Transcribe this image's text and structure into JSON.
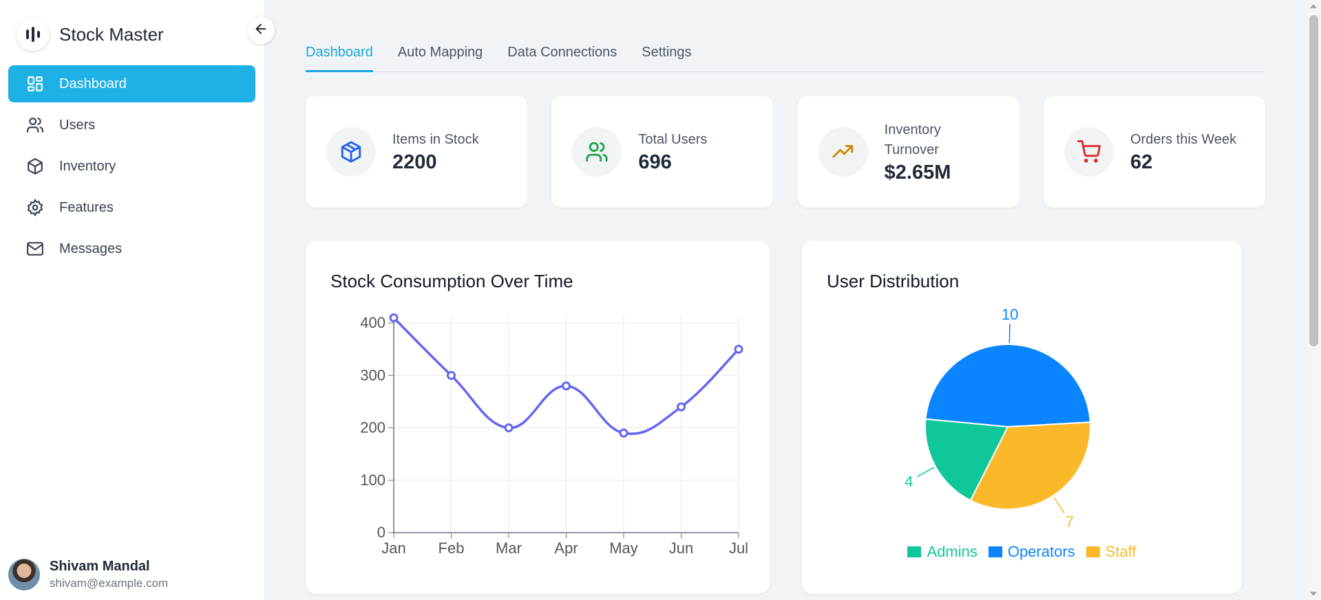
{
  "app": {
    "title": "Stock Master",
    "logo_icon": "bars-logo-icon",
    "collapse_icon": "arrow-left-icon"
  },
  "sidebar": {
    "items": [
      {
        "label": "Dashboard",
        "icon": "dashboard-grid-icon",
        "active": true
      },
      {
        "label": "Users",
        "icon": "users-icon",
        "active": false
      },
      {
        "label": "Inventory",
        "icon": "box-icon",
        "active": false
      },
      {
        "label": "Features",
        "icon": "gear-icon",
        "active": false
      },
      {
        "label": "Messages",
        "icon": "mail-icon",
        "active": false
      }
    ]
  },
  "user": {
    "name": "Shivam Mandal",
    "email": "shivam@example.com"
  },
  "tabs": [
    {
      "label": "Dashboard",
      "active": true
    },
    {
      "label": "Auto Mapping",
      "active": false
    },
    {
      "label": "Data Connections",
      "active": false
    },
    {
      "label": "Settings",
      "active": false
    }
  ],
  "stats": [
    {
      "label": "Items in Stock",
      "value": "2200",
      "icon": "box-icon",
      "color": "#2563eb"
    },
    {
      "label": "Total Users",
      "value": "696",
      "icon": "users-icon",
      "color": "#16a34a"
    },
    {
      "label": "Inventory Turnover",
      "value": "$2.65M",
      "icon": "trending-up-icon",
      "color": "#ca8a04"
    },
    {
      "label": "Orders this Week",
      "value": "62",
      "icon": "shopping-cart-icon",
      "color": "#dc2626"
    }
  ],
  "colors": {
    "accent": "#1fb0e6",
    "line": "#6366f1",
    "admins": "#10c79a",
    "operators": "#0a84ff",
    "staff": "#fbb829"
  },
  "chart_data": [
    {
      "type": "line",
      "title": "Stock Consumption Over Time",
      "categories": [
        "Jan",
        "Feb",
        "Mar",
        "Apr",
        "May",
        "Jun",
        "Jul"
      ],
      "values": [
        410,
        300,
        200,
        280,
        190,
        240,
        350
      ],
      "ylim": [
        0,
        400
      ],
      "yticks": [
        0,
        100,
        200,
        300,
        400
      ],
      "grid": true,
      "xlabel": "",
      "ylabel": ""
    },
    {
      "type": "pie",
      "title": "User Distribution",
      "labels": [
        "Admins",
        "Operators",
        "Staff"
      ],
      "values": [
        4,
        10,
        7
      ],
      "legend": "bottom"
    }
  ]
}
